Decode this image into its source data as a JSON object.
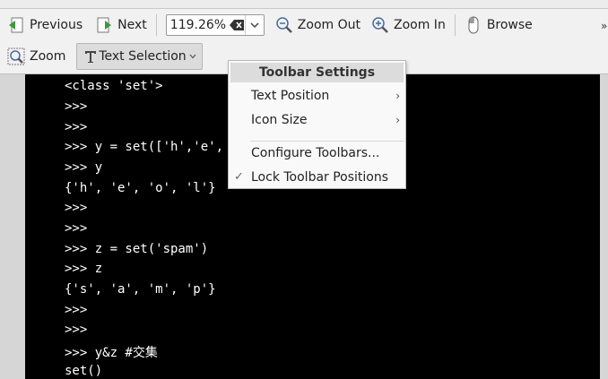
{
  "toolbar": {
    "previous_label": "Previous",
    "next_label": "Next",
    "zoom_value": "119.26%",
    "zoom_out_label": "Zoom Out",
    "zoom_in_label": "Zoom In",
    "browse_label": "Browse",
    "zoom_label": "Zoom",
    "text_selection_label": "Text Selection",
    "overflow_glyph": "»"
  },
  "document": {
    "lines": [
      "<class 'set'>",
      ">>>",
      ">>>",
      ">>> y = set(['h','e',",
      ">>> y",
      "{'h', 'e', 'o', 'l'}",
      ">>>",
      ">>>",
      ">>> z = set('spam')",
      ">>> z",
      "{'s', 'a', 'm', 'p'}",
      ">>>",
      ">>>",
      ">>> y&z #交集",
      "set()"
    ]
  },
  "context_menu": {
    "title": "Toolbar Settings",
    "items": [
      {
        "label": "Text Position",
        "submenu": "›"
      },
      {
        "label": "Icon Size",
        "submenu": "›"
      },
      {
        "label": "Configure Toolbars..."
      },
      {
        "label": "Lock Toolbar Positions",
        "check": "✓"
      }
    ]
  },
  "icons": {
    "previous": "previous-page-icon",
    "next": "next-page-icon",
    "clear": "clear-field-icon",
    "zoom_out": "zoom-out-icon",
    "zoom_in": "zoom-in-icon",
    "browse": "mouse-icon",
    "zoom": "zoom-tool-icon",
    "text_selection": "text-tool-icon"
  },
  "colors": {
    "document_background": "#000000",
    "document_text": "#ffffff",
    "toolbar_background": "#f1f1f1",
    "menu_title_background": "#dcdcdc"
  }
}
